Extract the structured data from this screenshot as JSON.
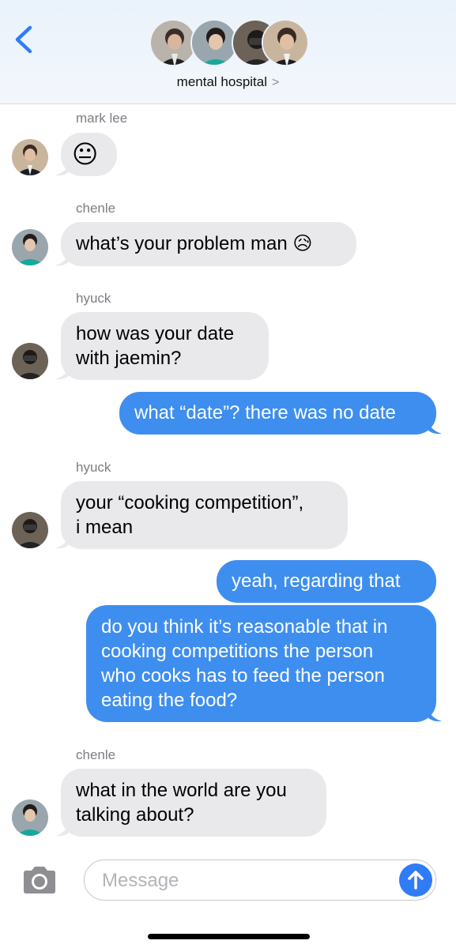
{
  "header": {
    "back_icon": "chevron-left-icon",
    "group_name": "mental hospital",
    "group_chevron": ">",
    "member_avatars": [
      "avatar-1",
      "avatar-2",
      "avatar-3",
      "avatar-4"
    ]
  },
  "messages": [
    {
      "direction": "incoming",
      "sender": "mark lee",
      "text": "😐"
    },
    {
      "direction": "incoming",
      "sender": "chenle",
      "text": "what’s your problem man 😥"
    },
    {
      "direction": "incoming",
      "sender": "hyuck",
      "lines": [
        "how was your date",
        "with jaemin?"
      ]
    },
    {
      "direction": "outgoing",
      "text": "what “date”? there was no date"
    },
    {
      "direction": "incoming",
      "sender": "hyuck",
      "lines": [
        "your “cooking competition”,",
        "i mean"
      ]
    },
    {
      "direction": "outgoing",
      "text": "yeah, regarding that"
    },
    {
      "direction": "outgoing",
      "lines": [
        "do you think it’s reasonable that in",
        "cooking competitions the person",
        "who cooks has to feed the person",
        "eating the food?"
      ]
    },
    {
      "direction": "incoming",
      "sender": "chenle",
      "lines": [
        "what in the world are you",
        "talking about?"
      ]
    }
  ],
  "composer": {
    "camera_icon": "camera-icon",
    "placeholder": "Message",
    "send_icon": "arrow-up-icon"
  },
  "colors": {
    "outgoing_bubble": "#3e8ef0",
    "incoming_bubble": "#e9e9eb",
    "accent": "#2f7cf6"
  }
}
